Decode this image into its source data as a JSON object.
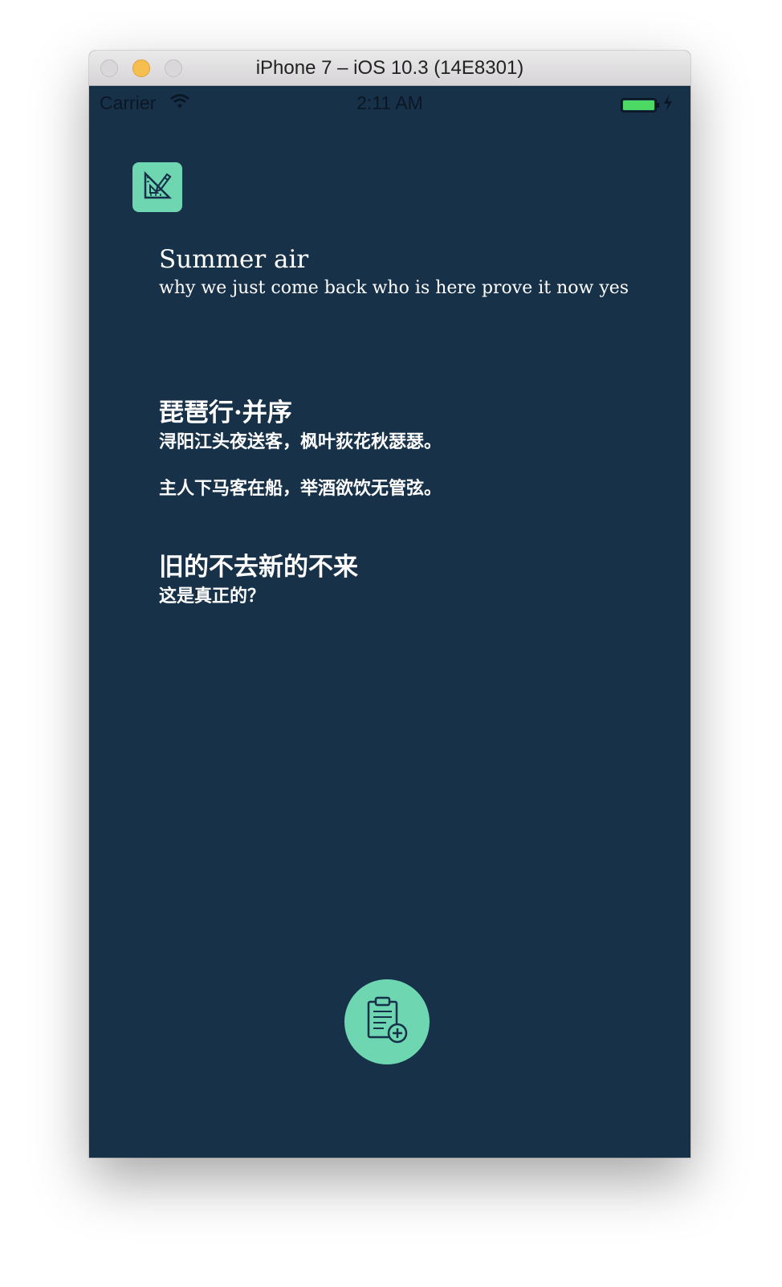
{
  "window": {
    "title": "iPhone 7 – iOS 10.3 (14E8301)"
  },
  "status_bar": {
    "carrier": "Carrier",
    "time": "2:11 AM"
  },
  "icons": {
    "top_button": "ruler-pencil-icon",
    "fab": "clipboard-add-icon"
  },
  "colors": {
    "background": "#173149",
    "accent": "#6ed6b1",
    "text": "#ffffff"
  },
  "entries": [
    {
      "title": "Summer air",
      "lines": [
        "why we just come back who is here  prove it now yes"
      ]
    },
    {
      "title": "琵琶行·并序",
      "lines": [
        "浔阳江头夜送客，枫叶荻花秋瑟瑟。",
        "主人下马客在船，举酒欲饮无管弦。"
      ]
    },
    {
      "title": "旧的不去新的不来",
      "lines": [
        "这是真正的？"
      ]
    }
  ]
}
